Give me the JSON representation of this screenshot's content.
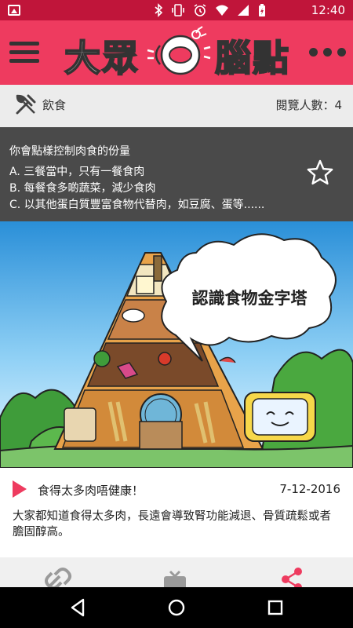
{
  "status_bar": {
    "time": "12:40",
    "icons": [
      "gallery-icon",
      "bluetooth-icon",
      "vibrate-icon",
      "alarm-icon",
      "wifi-icon",
      "signal-icon",
      "battery-icon"
    ]
  },
  "app_bar": {
    "logo_text": "大眾腦點",
    "colors": {
      "bar": "#ee3b5f",
      "status": "#c0153a"
    }
  },
  "category": {
    "label": "飲食",
    "views": "閱覽人數：4"
  },
  "question": {
    "title": "你會點樣控制肉食的份量",
    "options": [
      "A. 三餐當中，只有一餐食肉",
      "B. 每餐食多啲蔬菜，減少食肉",
      "C. 以其他蛋白質豐富食物代替肉，如豆腐、蛋等......"
    ]
  },
  "illustration": {
    "bubble_text": "認識食物金字塔"
  },
  "article": {
    "title": "食得太多肉唔健康！",
    "date": "7-12-2016",
    "body": "大家都知道食得太多肉，長遠會導致腎功能減退、骨質疏鬆或者膽固醇高。"
  },
  "actions": [
    "link-icon",
    "tv-icon",
    "share-icon"
  ]
}
